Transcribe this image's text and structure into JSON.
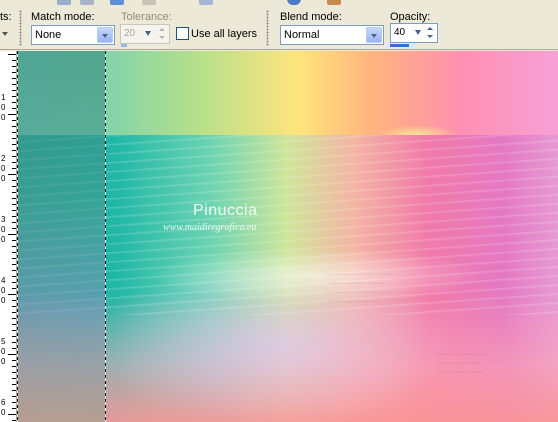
{
  "toolbar_partial": {
    "clipped_label": "ts:",
    "icons": [
      "app-icon-1",
      "app-icon-2",
      "app-icon-3",
      "app-icon-4",
      "app-icon-5",
      "app-icon-6",
      "app-icon-7"
    ]
  },
  "options": {
    "match_mode": {
      "label": "Match mode:",
      "value": "None"
    },
    "tolerance": {
      "label": "Tolerance:",
      "value": "20",
      "enabled": false
    },
    "use_all_layers": {
      "label": "Use all layers",
      "checked": false
    },
    "blend_mode": {
      "label": "Blend mode:",
      "value": "Normal"
    },
    "opacity": {
      "label": "Opacity:",
      "value": "40"
    }
  },
  "ruler": {
    "labels": [
      [
        "1",
        "0",
        "0"
      ],
      [
        "2",
        "0",
        "0"
      ],
      [
        "3",
        "0",
        "0"
      ],
      [
        "4",
        "0",
        "0"
      ],
      [
        "5",
        "0",
        "0"
      ],
      [
        "6",
        "0"
      ]
    ]
  },
  "canvas": {
    "watermark_title": "Pinuccia",
    "watermark_url": "www.maidiregrafica.eu"
  },
  "colors": {
    "panel_bg": "#ECE9D8",
    "field_border": "#7F9DB9",
    "accent": "#3A6ED4"
  }
}
